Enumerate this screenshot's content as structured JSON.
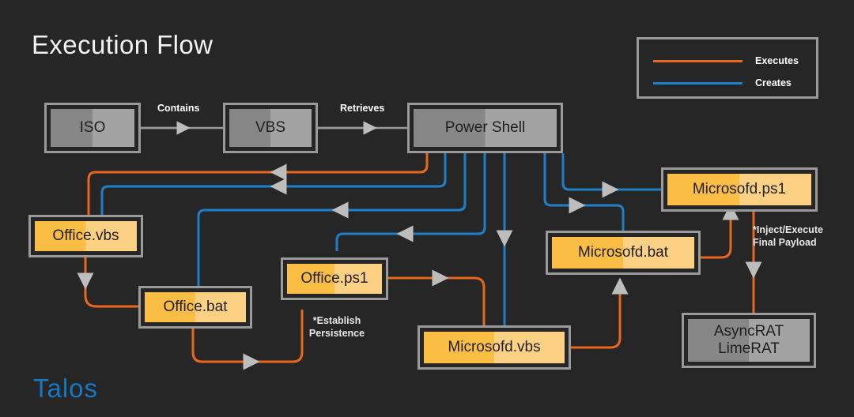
{
  "title": "Execution Flow",
  "brand": {
    "logo_text": "Talos",
    "logo_color": "#1678c2"
  },
  "colors": {
    "background": "#262626",
    "executes": "#e8671c",
    "creates": "#1e7fc8",
    "neutral_line": "#9a9a9a",
    "node_border": "#9a9a9a",
    "gray_fill_dark": "#878787",
    "gray_fill_light": "#a3a3a3",
    "yellow_fill_dark": "#fbbe45",
    "yellow_fill_light": "#fdd184",
    "arrow_head": "#bdbdbd"
  },
  "legend": {
    "items": [
      {
        "label": "Executes",
        "color": "#e8671c"
      },
      {
        "label": "Creates",
        "color": "#1e7fc8"
      }
    ]
  },
  "nodes": [
    {
      "id": "iso",
      "label": "ISO",
      "kind": "gray"
    },
    {
      "id": "vbs",
      "label": "VBS",
      "kind": "gray"
    },
    {
      "id": "powershell",
      "label": "Power Shell",
      "kind": "gray"
    },
    {
      "id": "office_vbs",
      "label": "Office.vbs",
      "kind": "yellow"
    },
    {
      "id": "office_bat",
      "label": "Office.bat",
      "kind": "yellow"
    },
    {
      "id": "office_ps1",
      "label": "Office.ps1",
      "kind": "yellow"
    },
    {
      "id": "microsofd_vbs",
      "label": "Microsofd.vbs",
      "kind": "yellow"
    },
    {
      "id": "microsofd_bat",
      "label": "Microsofd.bat",
      "kind": "yellow"
    },
    {
      "id": "microsofd_ps1",
      "label": "Microsofd.ps1",
      "kind": "yellow"
    },
    {
      "id": "rat",
      "label": "AsyncRAT\nLimeRAT",
      "kind": "gray"
    }
  ],
  "edge_labels": [
    {
      "id": "contains",
      "text": "Contains"
    },
    {
      "id": "retrieves",
      "text": "Retrieves"
    }
  ],
  "annotations": [
    {
      "id": "persistence",
      "text": "*Establish\nPersistence"
    },
    {
      "id": "payload",
      "text": "*Inject/Execute\nFinal Payload"
    }
  ]
}
